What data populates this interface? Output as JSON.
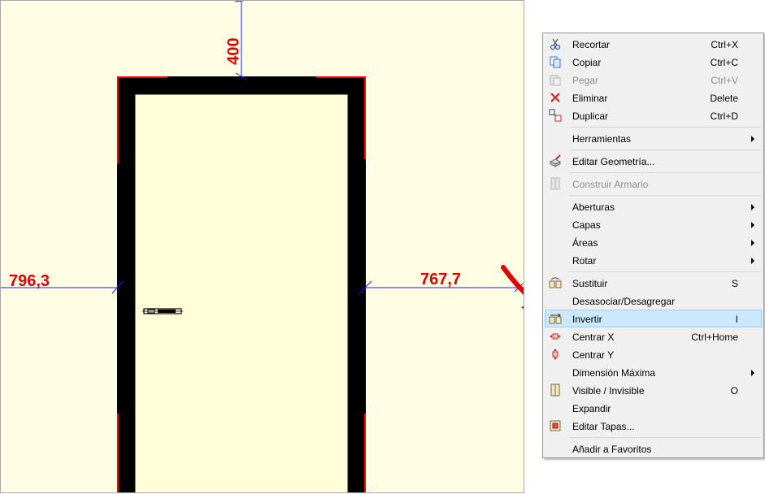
{
  "drawing": {
    "dim_top": "400",
    "dim_left": "796,3",
    "dim_right": "767,7"
  },
  "colors": {
    "canvas_bg": "#fffee4",
    "frame": "#000000",
    "dimension": "#e00000",
    "dim_line": "#1a1aff",
    "highlight": "#cce8ff",
    "arrow": "#e00000"
  },
  "menu": {
    "items": [
      {
        "label": "Recortar",
        "shortcut": "Ctrl+X",
        "icon": "scissors-icon"
      },
      {
        "label": "Copiar",
        "shortcut": "Ctrl+C",
        "icon": "copy-icon"
      },
      {
        "label": "Pegar",
        "shortcut": "Ctrl+V",
        "icon": "paste-icon",
        "disabled": true
      },
      {
        "label": "Eliminar",
        "shortcut": "Delete",
        "icon": "delete-icon"
      },
      {
        "label": "Duplicar",
        "shortcut": "Ctrl+D",
        "icon": "duplicate-icon"
      },
      {
        "label": "Herramientas",
        "submenu": true
      },
      {
        "label": "Editar Geometría...",
        "icon": "edit-geometry-icon"
      },
      {
        "label": "Construir Armario",
        "icon": "build-wardrobe-icon",
        "disabled": true
      },
      {
        "label": "Aberturas",
        "submenu": true
      },
      {
        "label": "Capas",
        "submenu": true
      },
      {
        "label": "Áreas",
        "submenu": true
      },
      {
        "label": "Rotar",
        "submenu": true
      },
      {
        "label": "Sustituir",
        "shortcut": "S",
        "icon": "replace-icon"
      },
      {
        "label": "Desasociar/Desagregar"
      },
      {
        "label": "Invertir",
        "shortcut": "I",
        "icon": "invert-icon",
        "highlighted": true
      },
      {
        "label": "Centrar X",
        "shortcut": "Ctrl+Home",
        "icon": "center-x-icon"
      },
      {
        "label": "Centrar Y",
        "icon": "center-y-icon"
      },
      {
        "label": "Dimensión Máxima",
        "submenu": true
      },
      {
        "label": "Visible / Invisible",
        "shortcut": "O",
        "icon": "visibility-icon"
      },
      {
        "label": "Expandir"
      },
      {
        "label": "Editar Tapas...",
        "icon": "edit-covers-icon"
      },
      {
        "label": "Añadir a Favoritos"
      }
    ]
  }
}
